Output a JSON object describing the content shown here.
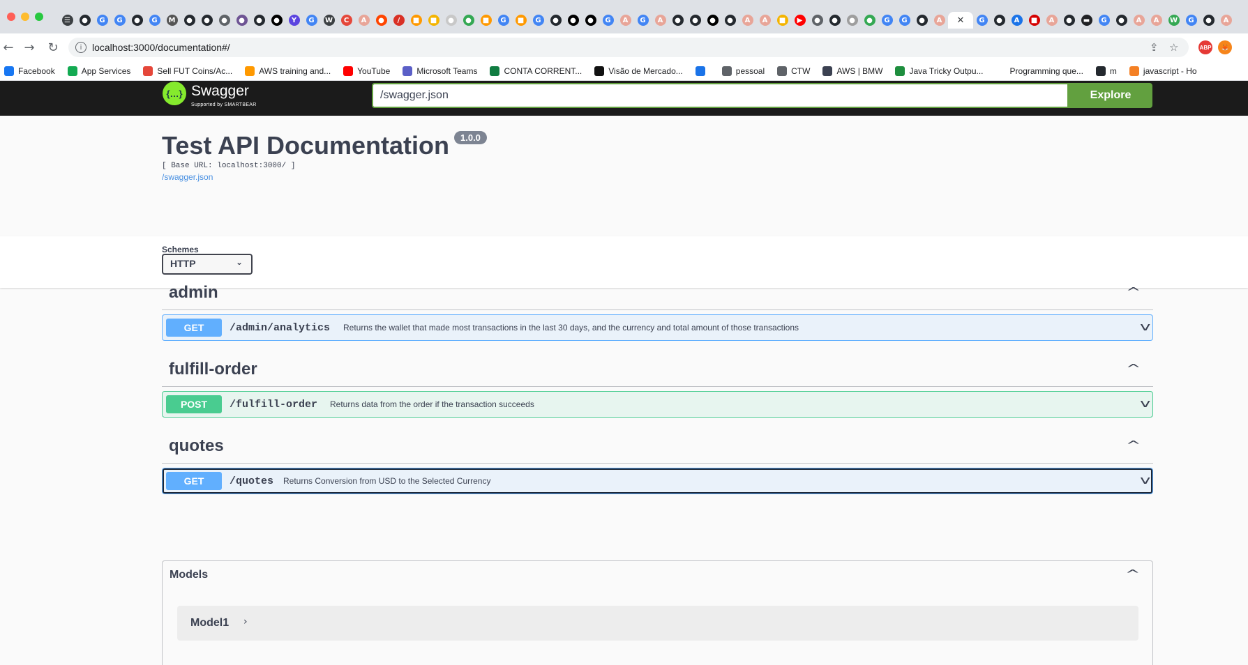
{
  "browser": {
    "url": "localhost:3000/documentation#/",
    "active_tab_close": "✕",
    "tab_favicons": [
      {
        "icon": "tab-strip-icon",
        "glyph": "☰",
        "color": "#3c4043"
      },
      {
        "icon": "github-icon",
        "glyph": "●",
        "color": "#24292f"
      },
      {
        "icon": "google-icon",
        "glyph": "G",
        "color": "#4285f4"
      },
      {
        "icon": "google-icon",
        "glyph": "G",
        "color": "#4285f4"
      },
      {
        "icon": "github-icon",
        "glyph": "●",
        "color": "#24292f"
      },
      {
        "icon": "google-icon",
        "glyph": "G",
        "color": "#4285f4"
      },
      {
        "icon": "medium-icon",
        "glyph": "M",
        "color": "#555555"
      },
      {
        "icon": "github-icon",
        "glyph": "●",
        "color": "#24292f"
      },
      {
        "icon": "github-icon",
        "glyph": "●",
        "color": "#24292f"
      },
      {
        "icon": "chrome-icon",
        "glyph": "●",
        "color": "#5f6368"
      },
      {
        "icon": "github-icon",
        "glyph": "●",
        "color": "#6e5494"
      },
      {
        "icon": "github-icon",
        "glyph": "●",
        "color": "#24292f"
      },
      {
        "icon": "medium-icon",
        "glyph": "●",
        "color": "#000000"
      },
      {
        "icon": "tab-icon",
        "glyph": "Y",
        "color": "#5b44e0"
      },
      {
        "icon": "google-icon",
        "glyph": "G",
        "color": "#4285f4"
      },
      {
        "icon": "tab-icon",
        "glyph": "W",
        "color": "#3c4043"
      },
      {
        "icon": "tab-icon",
        "glyph": "C",
        "color": "#e5473a"
      },
      {
        "icon": "tab-icon",
        "glyph": "A",
        "color": "#e8a598"
      },
      {
        "icon": "reddit-icon",
        "glyph": "●",
        "color": "#ff4500"
      },
      {
        "icon": "tab-icon",
        "glyph": "/",
        "color": "#d93025"
      },
      {
        "icon": "aws-icon",
        "glyph": "■",
        "color": "#ff9900"
      },
      {
        "icon": "tab-icon",
        "glyph": "■",
        "color": "#f4b400"
      },
      {
        "icon": "tab-icon",
        "glyph": "●",
        "color": "#c8c8c8"
      },
      {
        "icon": "tab-icon",
        "glyph": "●",
        "color": "#34a853"
      },
      {
        "icon": "aws-icon",
        "glyph": "■",
        "color": "#ff9900"
      },
      {
        "icon": "google-icon",
        "glyph": "G",
        "color": "#4285f4"
      },
      {
        "icon": "aws-icon",
        "glyph": "■",
        "color": "#ff9900"
      },
      {
        "icon": "google-icon",
        "glyph": "G",
        "color": "#4285f4"
      },
      {
        "icon": "github-icon",
        "glyph": "●",
        "color": "#24292f"
      },
      {
        "icon": "medium-icon",
        "glyph": "●",
        "color": "#000000"
      },
      {
        "icon": "medium-icon",
        "glyph": "●",
        "color": "#000000"
      },
      {
        "icon": "google-icon",
        "glyph": "G",
        "color": "#4285f4"
      },
      {
        "icon": "tab-icon",
        "glyph": "A",
        "color": "#e8a598"
      },
      {
        "icon": "google-icon",
        "glyph": "G",
        "color": "#4285f4"
      },
      {
        "icon": "tab-icon",
        "glyph": "A",
        "color": "#e8a598"
      },
      {
        "icon": "github-icon",
        "glyph": "●",
        "color": "#24292f"
      },
      {
        "icon": "github-icon",
        "glyph": "●",
        "color": "#24292f"
      },
      {
        "icon": "medium-icon",
        "glyph": "●",
        "color": "#000000"
      },
      {
        "icon": "github-icon",
        "glyph": "●",
        "color": "#24292f"
      },
      {
        "icon": "tab-icon",
        "glyph": "A",
        "color": "#e8a598"
      },
      {
        "icon": "tab-icon",
        "glyph": "A",
        "color": "#e8a598"
      },
      {
        "icon": "tab-icon",
        "glyph": "■",
        "color": "#f4b400"
      },
      {
        "icon": "youtube-icon",
        "glyph": "▶",
        "color": "#ff0000"
      },
      {
        "icon": "chrome-icon",
        "glyph": "●",
        "color": "#5f6368"
      },
      {
        "icon": "github-icon",
        "glyph": "●",
        "color": "#24292f"
      },
      {
        "icon": "tab-icon",
        "glyph": "●",
        "color": "#9e9e9e"
      },
      {
        "icon": "tab-icon",
        "glyph": "●",
        "color": "#34a853"
      },
      {
        "icon": "google-icon",
        "glyph": "G",
        "color": "#4285f4"
      },
      {
        "icon": "google-icon",
        "glyph": "G",
        "color": "#4285f4"
      },
      {
        "icon": "github-icon",
        "glyph": "●",
        "color": "#24292f"
      },
      {
        "icon": "tab-icon",
        "glyph": "A",
        "color": "#e8a598"
      }
    ],
    "tab_favicons_after": [
      {
        "icon": "google-icon",
        "glyph": "G",
        "color": "#4285f4"
      },
      {
        "icon": "github-icon",
        "glyph": "●",
        "color": "#24292f"
      },
      {
        "icon": "tab-icon",
        "glyph": "A",
        "color": "#1a73e8"
      },
      {
        "icon": "tab-icon",
        "glyph": "■",
        "color": "#d50000"
      },
      {
        "icon": "tab-icon",
        "glyph": "A",
        "color": "#e8a598"
      },
      {
        "icon": "github-icon",
        "glyph": "●",
        "color": "#24292f"
      },
      {
        "icon": "tab-icon",
        "glyph": "▬",
        "color": "#202124"
      },
      {
        "icon": "google-icon",
        "glyph": "G",
        "color": "#4285f4"
      },
      {
        "icon": "github-icon",
        "glyph": "●",
        "color": "#24292f"
      },
      {
        "icon": "tab-icon",
        "glyph": "A",
        "color": "#e8a598"
      },
      {
        "icon": "tab-icon",
        "glyph": "A",
        "color": "#e8a598"
      },
      {
        "icon": "tab-icon",
        "glyph": "W",
        "color": "#34a853"
      },
      {
        "icon": "google-icon",
        "glyph": "G",
        "color": "#4285f4"
      },
      {
        "icon": "github-icon",
        "glyph": "●",
        "color": "#24292f"
      },
      {
        "icon": "tab-icon",
        "glyph": "A",
        "color": "#e8a598"
      }
    ],
    "extensions": [
      {
        "name": "adblock-extension",
        "label": "ABP",
        "color": "#e53935"
      },
      {
        "name": "metamask-extension",
        "label": "🦊",
        "color": "#f6851b"
      }
    ],
    "bookmarks": [
      {
        "label": "Facebook",
        "color": "#1877f2"
      },
      {
        "label": "App Services",
        "color": "#13aa52"
      },
      {
        "label": "Sell FUT Coins/Ac...",
        "color": "#e5473a"
      },
      {
        "label": "AWS training and...",
        "color": "#ff9900"
      },
      {
        "label": "YouTube",
        "color": "#ff0000"
      },
      {
        "label": "Microsoft Teams",
        "color": "#5b5fc7"
      },
      {
        "label": "CONTA CORRENT...",
        "color": "#107c41"
      },
      {
        "label": "Visão de Mercado...",
        "color": "#111111"
      },
      {
        "label": "",
        "color": "#1a73e8"
      },
      {
        "label": "pessoal",
        "color": "#5f6368"
      },
      {
        "label": "CTW",
        "color": "#5f6368"
      },
      {
        "label": "AWS | BMW",
        "color": "#3b4151"
      },
      {
        "label": "Java Tricky Outpu...",
        "color": "#1e8e3e"
      },
      {
        "label": "Programming que...",
        "color": "#ffffff"
      },
      {
        "label": "m",
        "color": "#24292f"
      },
      {
        "label": "javascript - Ho",
        "color": "#f48024"
      }
    ]
  },
  "swagger": {
    "logo_text": "Swagger",
    "logo_sub": "Supported by SMARTBEAR",
    "spec_url": "/swagger.json",
    "explore_label": "Explore"
  },
  "info": {
    "title": "Test API Documentation",
    "version": "1.0.0",
    "base_url": "[ Base URL: localhost:3000/ ]",
    "spec_link": "/swagger.json"
  },
  "schemes": {
    "label": "Schemes",
    "selected": "HTTP"
  },
  "tags": [
    {
      "name": "admin",
      "operations": [
        {
          "method": "GET",
          "path": "/admin/analytics",
          "summary": "Returns the wallet that made most transactions in the last 30 days, and the currency and total amount of those transactions"
        }
      ]
    },
    {
      "name": "fulfill-order",
      "operations": [
        {
          "method": "POST",
          "path": "/fulfill-order",
          "summary": "Returns data from the order if the transaction succeeds"
        }
      ]
    },
    {
      "name": "quotes",
      "operations": [
        {
          "method": "GET",
          "path": "/quotes",
          "summary": "Returns Conversion from USD to the Selected Currency"
        }
      ]
    }
  ],
  "models": {
    "title": "Models",
    "items": [
      {
        "name": "Model1"
      }
    ]
  }
}
